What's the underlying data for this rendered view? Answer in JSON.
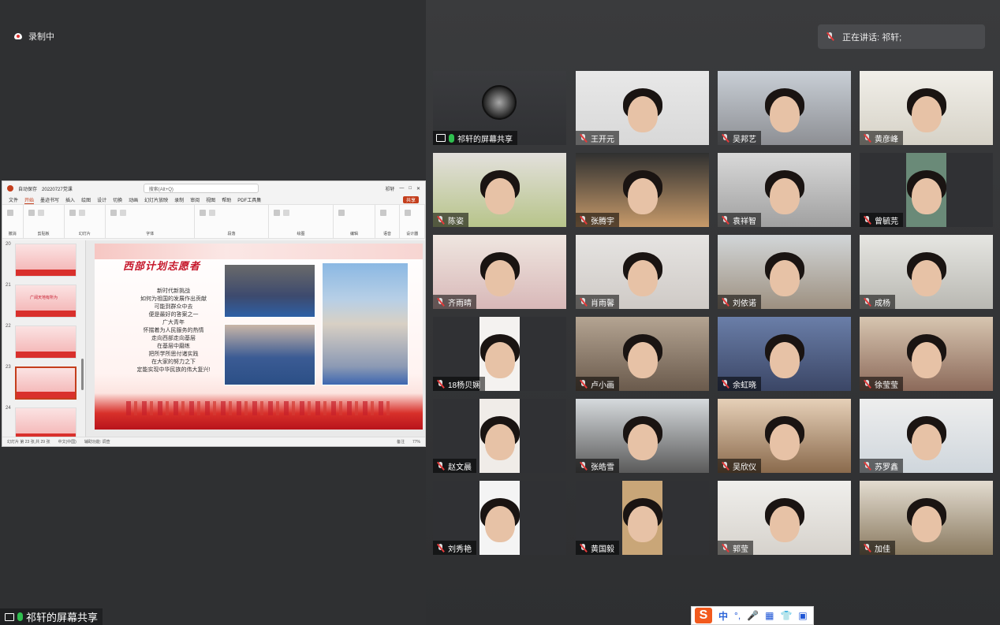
{
  "recording": {
    "label": "录制中"
  },
  "bottom_bar": {
    "share_label": "祁轩的屏幕共享"
  },
  "speaker": {
    "label": "正在讲话: 祁轩;"
  },
  "ppt": {
    "autosave": "自动保存",
    "filename": "20220727党课",
    "search_placeholder": "搜索(Alt+Q)",
    "user": "祁轩",
    "menu": [
      "文件",
      "开始",
      "墨迹书写",
      "插入",
      "绘图",
      "设计",
      "切换",
      "动画",
      "幻灯片放映",
      "录制",
      "审阅",
      "视图",
      "帮助",
      "PDF工具集"
    ],
    "share_btn": "共享",
    "ribbon_groups": [
      "撤消",
      "剪贴板",
      "幻灯片",
      "字体",
      "段落",
      "绘图",
      "编辑",
      "语音",
      "设计器"
    ],
    "thumbs": [
      {
        "num": "20",
        "text": ""
      },
      {
        "num": "21",
        "text": "广阔天地有所为"
      },
      {
        "num": "22",
        "text": ""
      },
      {
        "num": "23",
        "text": ""
      },
      {
        "num": "24",
        "text": ""
      }
    ],
    "slide_title": "西部计划志愿者",
    "slide_poem": [
      "新时代新挑战",
      "如何为祖国的发展作出贡献",
      "可能到群众中去",
      "便是最好的答案之一",
      "广大青年",
      "怀揣着为人民服务的热情",
      "走向西部走向基层",
      "在基层中磨练",
      "把所学所思付诸实践",
      "在大家的努力之下",
      "定能实现中华民族的伟大复兴!"
    ],
    "status_left": "幻灯片 第 23 张,共 29 张",
    "status_lang": "中文(中国)",
    "status_access": "辅助功能: 调查",
    "status_notes": "备注",
    "status_zoom": "77%"
  },
  "participants": [
    {
      "name": "祁轩的屏幕共享",
      "type": "share"
    },
    {
      "name": "王开元"
    },
    {
      "name": "吴邦艺"
    },
    {
      "name": "黄彦峰"
    },
    {
      "name": "陈姿"
    },
    {
      "name": "张腾宇"
    },
    {
      "name": "袁祥智"
    },
    {
      "name": "曾毓芫"
    },
    {
      "name": "齐雨晴"
    },
    {
      "name": "肖雨馨"
    },
    {
      "name": "刘依诺"
    },
    {
      "name": "成杨"
    },
    {
      "name": "18杨贝娴"
    },
    {
      "name": "卢小画"
    },
    {
      "name": "余虹晓"
    },
    {
      "name": "徐莹莹"
    },
    {
      "name": "赵文晨"
    },
    {
      "name": "张皓雪"
    },
    {
      "name": "吴欣仪"
    },
    {
      "name": "苏罗鑫"
    },
    {
      "name": "刘秀艳"
    },
    {
      "name": "黄国毅"
    },
    {
      "name": "郭莹"
    },
    {
      "name": "加佳"
    }
  ],
  "ime": {
    "mode": "中"
  },
  "colors": {
    "accent_red": "#c43e1c",
    "active_green": "#3dba5a",
    "muted_red": "#e43b3b"
  }
}
